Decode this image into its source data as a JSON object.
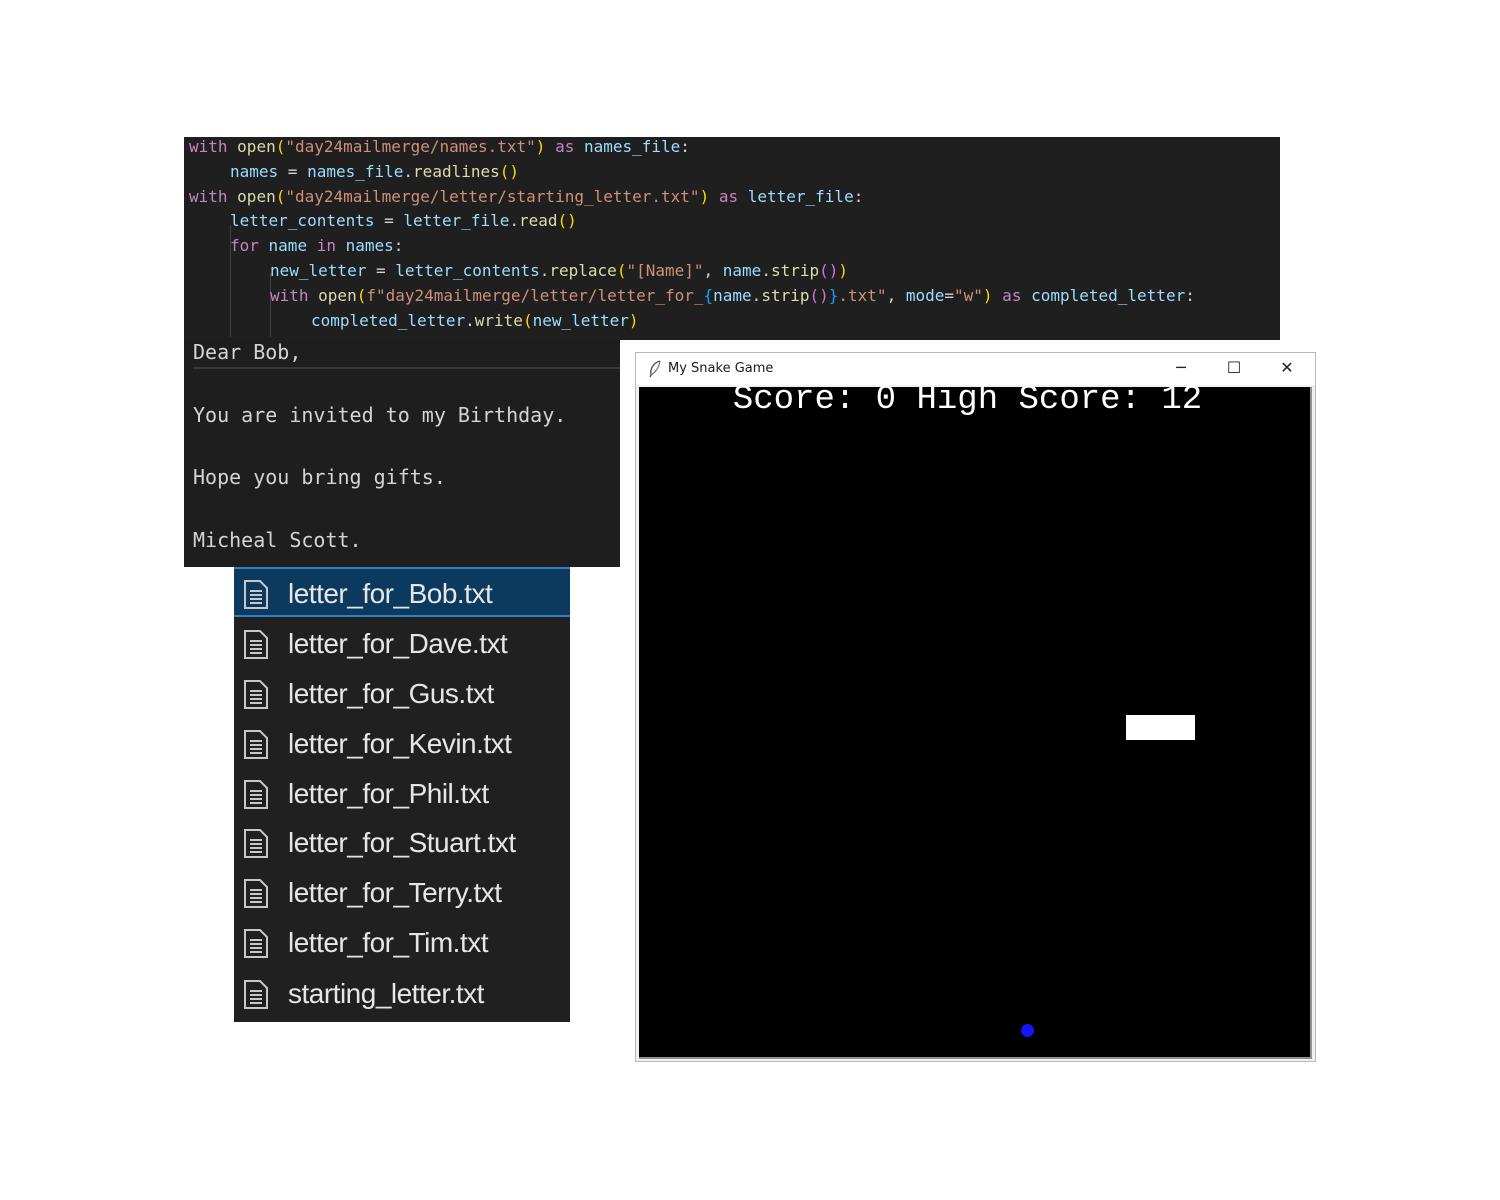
{
  "code_editor": {
    "line1": {
      "kw_with": "with",
      "fn_open": "open",
      "lp": "(",
      "path": "\"day24mailmerge/names.txt\"",
      "rp": ")",
      "kw_as": " as ",
      "var": "names_file",
      "colon": ":"
    },
    "line2": {
      "var": "names",
      "eq": " = ",
      "obj": "names_file",
      "dot": ".",
      "fn": "readlines",
      "parens": "()"
    },
    "line3": {
      "kw_with": "with",
      "fn_open": "open",
      "lp": "(",
      "path": "\"day24mailmerge/letter/starting_letter.txt\"",
      "rp": ")",
      "kw_as": " as ",
      "var": "letter_file",
      "colon": ":"
    },
    "line4": {
      "var": "letter_contents",
      "eq": " = ",
      "obj": "letter_file",
      "dot": ".",
      "fn": "read",
      "parens": "()"
    },
    "line5": {
      "kw_for": "for",
      "var": " name ",
      "kw_in": "in",
      "var2": " names",
      "colon": ":"
    },
    "line6": {
      "var": "new_letter",
      "eq": " = ",
      "obj": "letter_contents",
      "dot": ".",
      "fn": "replace",
      "lp": "(",
      "arg1": "\"[Name]\"",
      "comma": ", ",
      "obj2": "name",
      "dot2": ".",
      "fn2": "strip",
      "inner": "()",
      "rp": ")"
    },
    "line7": {
      "kw_with": "with",
      "fn_open": " open",
      "lp": "(",
      "fpre": "f",
      "s1": "\"day24mailmerge/letter/letter_for_",
      "lb": "{",
      "expr_obj": "name",
      "expr_dot": ".",
      "expr_fn": "strip",
      "expr_parens": "()",
      "rb": "}",
      "s2": ".txt\"",
      "comma": ", ",
      "kwarg": "mode",
      "eq": "=",
      "modeval": "\"w\"",
      "rp": ")",
      "kw_as": " as ",
      "var": "completed_letter",
      "colon": ":"
    },
    "line8": {
      "obj": "completed_letter",
      "dot": ".",
      "fn": "write",
      "lp": "(",
      "arg": "new_letter",
      "rp": ")"
    }
  },
  "letter": {
    "salutation": "Dear Bob,",
    "body1": "You are invited to my Birthday.",
    "body2": "Hope you bring gifts.",
    "signature": "Micheal Scott."
  },
  "file_list": {
    "icon": "text-file-icon",
    "files": [
      "letter_for_Bob.txt",
      "letter_for_Dave.txt",
      "letter_for_Gus.txt",
      "letter_for_Kevin.txt",
      "letter_for_Phil.txt",
      "letter_for_Stuart.txt",
      "letter_for_Terry.txt",
      "letter_for_Tim.txt",
      "starting_letter.txt"
    ],
    "selected": "letter_for_Bob.txt",
    "selected_color": "#0b3a5e"
  },
  "snake_window": {
    "title": "My Snake Game",
    "minimize": "─",
    "maximize": "☐",
    "close": "✕",
    "score_text": "Score: 0 High Score: 12",
    "canvas_bg": "#000000",
    "snake_color": "#ffffff",
    "food_color": "#1414ff"
  }
}
